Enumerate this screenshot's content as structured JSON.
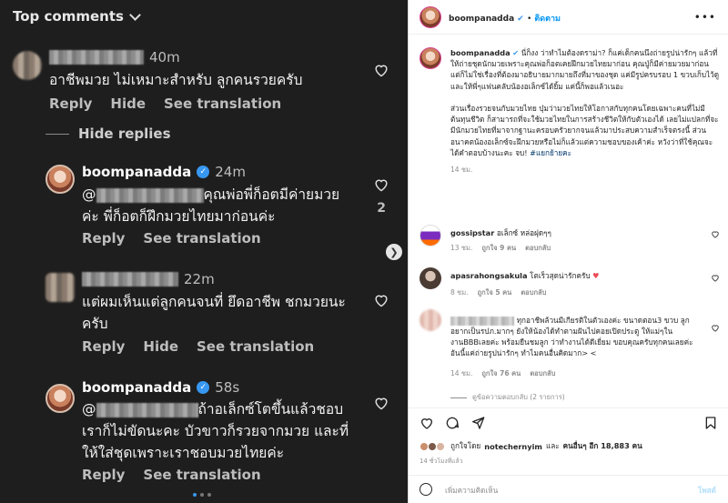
{
  "left": {
    "header": "Top comments",
    "comments": [
      {
        "time": "40m",
        "text": "อาชีพมวย ไม่เหมาะสำหรับ ลูกคนรวยครับ",
        "actions": [
          "Reply",
          "Hide",
          "See translation"
        ]
      }
    ],
    "hide_replies": "Hide replies",
    "replies": [
      {
        "username": "boompanadda",
        "time": "24m",
        "text1_prefix": "@",
        "text1_suffix": "คุณพ่อพี่ก็อตมีค่ายมวย",
        "text2": "ค่ะ พี่ก็อตก็ฝึกมวยไทยมาก่อนค่ะ",
        "actions": [
          "Reply",
          "See translation"
        ],
        "likes": "2"
      },
      {
        "time": "22m",
        "text1": "แต่ผมเห็นแต่ลูกคนจนที่ ยึดอาชีพ ชกมวยนะ",
        "text2": "ครับ",
        "actions": [
          "Reply",
          "Hide",
          "See translation"
        ]
      },
      {
        "username": "boompanadda",
        "time": "58s",
        "text1_prefix": "@",
        "text1_suffix": "ถ้าอเล็กซ์โตขึ้นแล้วชอบ",
        "text2": "เราก็ไม่ขัดนะคะ บัวขาวก็รวยจากมวย และที่",
        "text3": "ให้ใส่ชุดเพราะเราชอบมวยไทยค่ะ",
        "actions": [
          "Reply",
          "See translation"
        ]
      }
    ]
  },
  "right": {
    "header": {
      "username": "boompanadda",
      "separator": "•",
      "follow": "ติดตาม",
      "more": "•••"
    },
    "caption": {
      "username": "boompanadda",
      "p1": "นี่ก็งง ว่าทำไมต้องดราม่า? ก็แค่เด็กคนนึงถ่ายรูปน่ารักๆ แล้วที่ให้ถ่ายชุดนักมวยเพราะคุณพ่อก็อตเคยฝึกมวยไทยมาก่อน คุณปู่ก็มีค่ายมวยมาก่อน แต่ก็ไม่ใช่เรื่องที่ต้องมาอธิบายมากมายถึงที่มาของชุด แค่มีรูปครบรอบ 1 ขวบเก็บไว้ดู และให้พี่ๆแฟนคลับน้องอเล็กซ์ได้ยิ้ม แค่นี้ก็พอแล้วเนอะ",
      "p2": "ส่วนเรื่องรวยจนกับมวยไทย บุ๋มว่ามวยไทยให้โอกาสกับทุกคนโดยเฉพาะคนที่ไม่มีต้นทุนชีวิต ก็สามารถที่จะใช้มวยไทยในการสร้างชีวิตให้กับตัวเองได้ เลยไม่แปลกที่จะมีนักมวยไทยที่มาจากฐานะครอบครัวยากจนแล้วมาประสบความสำเร็จตรงนี้ ส่วนอนาคตน้องอเล็กซ์จะฝึกมวยหรือไม่ก็แล้วแต่ความชอบของเค้าค่ะ หวังว่าที่ใช้คุณจะได้คำตอบบ้างนะคะ จบ! ",
      "hashtag": "#แยกย้ายคะ",
      "time": "14 ชม."
    },
    "comments": [
      {
        "username": "gossipstar",
        "text": "อเล็กซ์ หล่อฝุดๆๆ",
        "time": "13 ชม.",
        "likes": "ถูกใจ 9 คน",
        "reply": "ตอบกลับ"
      },
      {
        "username": "apasrahongsakula",
        "text": "โตเร็วสุดน่ารักครับ",
        "time": "8 ชม.",
        "likes": "ถูกใจ 5 คน",
        "reply": "ตอบกลับ"
      },
      {
        "text": "ทุกอาชีพล้วนมีเกียรติในตัวเองค่ะ ขนาดตอน3 ขวบ ลูกอยากเป็นรปภ.มากๆ ยังให้น้องได้ทำตามฝันไปคอยเปิดประตู ให้แม่ๆในงานBBBเลยค่ะ พร้อมยืนชมลูก ว่าทำงานได้ดีเยี่ยม ขอบคุณครับทุกคนเลยค่ะ อันนี้แค่ถ่ายรูปน่ารักๆ ทำไมคนอื่นคิดมาก> <",
        "time": "14 ชม.",
        "likes": "ถูกใจ 76 คน",
        "reply": "ตอบกลับ"
      }
    ],
    "view_replies": "ดูข้อความตอบกลับ (2 รายการ)",
    "liked_by": {
      "prefix": "ถูกใจโดย",
      "user": "notechernyim",
      "mid": "และ",
      "others": "คนอื่นๆ อีก 18,883 คน"
    },
    "ago": "14 ชั่วโมงที่แล้ว",
    "add_comment": {
      "placeholder": "เพิ่มความคิดเห็น",
      "post": "โพสต์"
    },
    "colors": {
      "accent": "#0095f6",
      "heart_red": "#ed4956",
      "verified": "#3897f0"
    }
  }
}
